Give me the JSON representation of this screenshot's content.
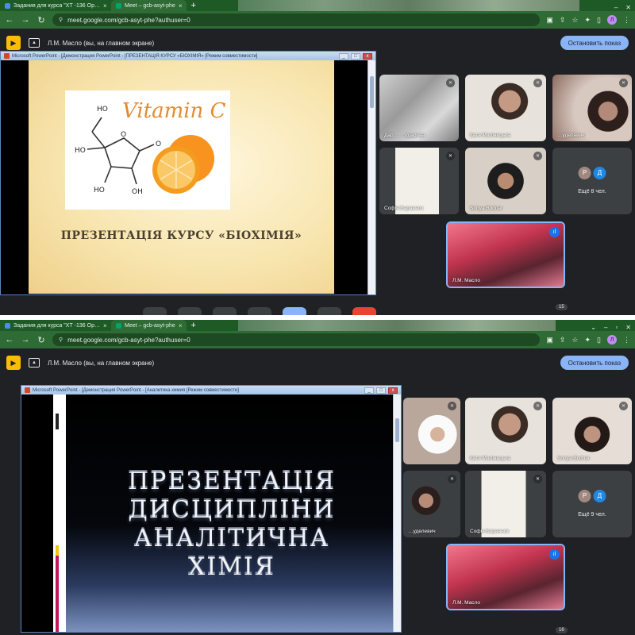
{
  "colors": {
    "chrome_dark": "#1e5a26",
    "chrome_light": "#2f6b35",
    "meet_bg": "#202124",
    "accent": "#8ab4f8",
    "end_call": "#ea4335"
  },
  "top": {
    "tabs": [
      {
        "label": "Задания для курса \"ХТ -136 Ор…"
      },
      {
        "label": "Meet – gcb-asyt-phe"
      }
    ],
    "url": "meet.google.com/gcb-asyt-phe?authuser=0",
    "presenting": "Л.М. Масло (вы, на главном экране)",
    "stop_button": "Остановить показ",
    "ppt_title": "Microsoft PowerPoint - [Демонстрация PowerPoint - [ПРЕЗЕНТАЦІЯ КУРСУ «БІОХІМІЯ» [Режим совместимости]",
    "slide_heading": "Vitamin C",
    "slide_title": "ПРЕЗЕНТАЦІЯ КУРСУ «БІОХІМІЯ»",
    "participants": [
      {
        "name": "Дар… …ударова"
      },
      {
        "name": "Катя Малінецька"
      },
      {
        "name": "…удепевич"
      },
      {
        "name": "Софія Бараннок"
      },
      {
        "name": "Sonya Bodnar"
      }
    ],
    "avatar_letters": [
      "Р",
      "Д"
    ],
    "more": "Ещё 8 чел.",
    "self_name": "Л.М. Масло",
    "badge": "15"
  },
  "bottom": {
    "tabs": [
      {
        "label": "Задания для курса \"ХТ -136 Ор…"
      },
      {
        "label": "Meet – gcb-asyt-phe"
      }
    ],
    "url": "meet.google.com/gcb-asyt-phe?authuser=0",
    "presenting": "Л.М. Масло (вы, на главном экране)",
    "stop_button": "Остановить показ",
    "ppt_title": "Microsoft PowerPoint - [Демонстрация PowerPoint - [Аналитика химия [Режим совместимости]",
    "slide_lines": [
      "ПРЕЗЕНТАЦІЯ",
      "ДИСЦИПЛІНИ",
      "АНАЛІТИЧНА",
      "ХІМІЯ"
    ],
    "participants": [
      {
        "name": ""
      },
      {
        "name": "Катя Малінецька"
      },
      {
        "name": "Sonya Bodnar"
      },
      {
        "name": "…уделевич"
      },
      {
        "name": "Софія Бараннок"
      }
    ],
    "avatar_letters": [
      "Р",
      "Д"
    ],
    "more": "Ещё 9 чел.",
    "self_name": "Л.М. Масло",
    "badge": "16"
  }
}
